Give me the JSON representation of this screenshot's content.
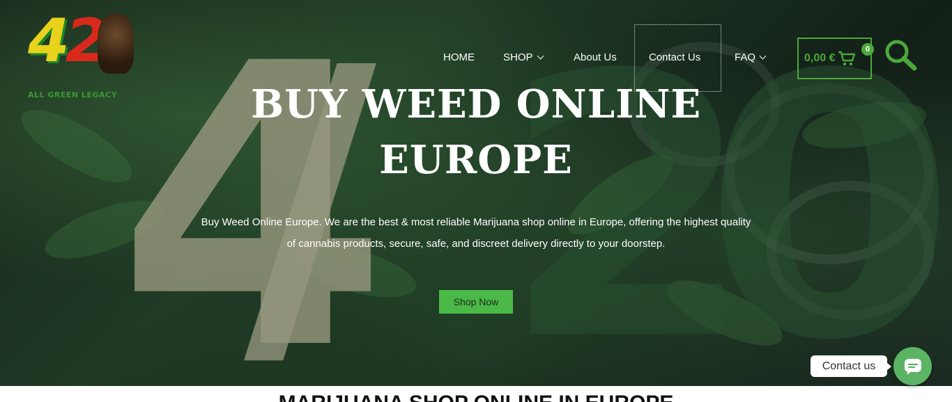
{
  "logo": {
    "numerals": [
      "4",
      "2"
    ],
    "subtitle": "ALL GREEN LEGACY"
  },
  "background_numerals": [
    "4",
    "/",
    "2",
    "0"
  ],
  "nav": {
    "items": [
      {
        "label": "HOME",
        "has_dropdown": false
      },
      {
        "label": "SHOP",
        "has_dropdown": true
      },
      {
        "label": "About Us",
        "has_dropdown": false
      },
      {
        "label": "Contact Us",
        "has_dropdown": false
      },
      {
        "label": "FAQ",
        "has_dropdown": true
      }
    ]
  },
  "cart": {
    "total": "0,00 €",
    "count": "0",
    "icon": "cart-icon"
  },
  "search": {
    "icon": "search-icon"
  },
  "hero": {
    "headline_line1": "BUY WEED ONLINE",
    "headline_line2": "EUROPE",
    "description": "Buy Weed Online Europe. We are the best & most reliable Marijuana shop online in Europe, offering the highest quality of cannabis products, secure, safe, and discreet delivery directly to your doorstep.",
    "cta_label": "Shop Now"
  },
  "contact_widget": {
    "label": "Contact us",
    "icon": "chat-icon"
  },
  "section": {
    "title": "MARIJUANA SHOP ONLINE IN EUROPE"
  },
  "colors": {
    "accent": "#4ca83c",
    "button": "#4bb947",
    "fab": "#5bb364",
    "text_light": "#ffffff"
  }
}
